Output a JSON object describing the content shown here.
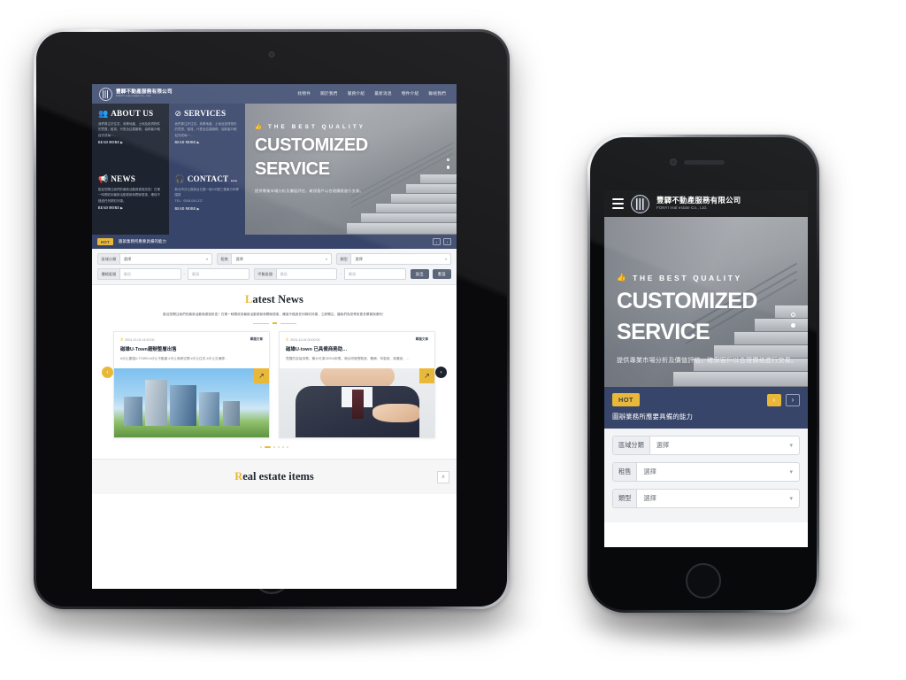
{
  "site": {
    "logo": {
      "cn": "豐驛不動產服務有限公司",
      "en": "FONYI real estate Co., Ltd.",
      "icon": "building-logo-icon"
    },
    "nav": [
      {
        "label": "找物件"
      },
      {
        "label": "關於我們"
      },
      {
        "label": "服務介紹"
      },
      {
        "label": "最新消息"
      },
      {
        "label": "物件介紹"
      },
      {
        "label": "聯絡我們"
      }
    ]
  },
  "cards": [
    {
      "id": "about-us",
      "icon": "people-icon",
      "glyph": "👥",
      "title": "ABOUT US",
      "body": "我們專注於住宅、商業地產、土地及投資物件的買賣、租賃、代售及估價服務，協助客戶輕鬆完成每一...",
      "more": "READ MORE ▶",
      "theme": "dark"
    },
    {
      "id": "services",
      "icon": "compass-icon",
      "glyph": "⊘",
      "title": "SERVICES",
      "body": "我們專注於住宅、商業地產、土地及投資物件的買賣、租賃、代售及估價服務，協助客戶輕鬆完成每一...",
      "more": "READ MORE ▶",
      "theme": "blue"
    },
    {
      "id": "news",
      "icon": "megaphone-icon",
      "glyph": "📢",
      "title": "NEWS",
      "body": "歡迎您關注我們的最新活動與優惠訊息！在第一時間收到最新活動更新和獨家優惠，確保不錯過任何精彩好康。",
      "more": "READ MORE ▶",
      "theme": "dark"
    },
    {
      "id": "contact",
      "icon": "headset-icon",
      "glyph": "🎧",
      "title": "CONTACT ...",
      "body": "新北市汐止區新台五路一段100號三樓東方科學園區",
      "tel": "TEL：0918-041-317",
      "more": "READ MORE ▶",
      "theme": "blue"
    }
  ],
  "hero": {
    "kicker": "THE BEST QUALITY",
    "kicker_icon": "thumbs-up-icon",
    "title_line1": "CUSTOMIZED",
    "title_line2": "SERVICE",
    "subtitle": "提供專業市場分析及價值評估，確保客戶以合理價格進行交易。",
    "dots": [
      "outline",
      "filled"
    ]
  },
  "hot": {
    "badge": "HOT",
    "text": "圖辦業務所應要具備的能力",
    "prev_icon": "chevron-left-icon",
    "next_icon": "chevron-right-icon",
    "prev": "‹",
    "next": "›"
  },
  "filter": {
    "row1": [
      {
        "label": "區域分類",
        "value": "選擇"
      },
      {
        "label": "租售",
        "value": "選擇"
      },
      {
        "label": "類型",
        "value": "選擇"
      }
    ],
    "row2": [
      {
        "label": "價格區間",
        "min": "最低",
        "max": "最高",
        "sep": "-"
      },
      {
        "label": "坪數區間",
        "min": "最低",
        "max": "最高",
        "sep": "-"
      }
    ],
    "buttons": [
      {
        "label": "送出"
      },
      {
        "label": "重設"
      }
    ],
    "caret_icon": "chevron-down-icon"
  },
  "news": {
    "title_first": "L",
    "title_rest": "atest News",
    "description": "歡迎您關注我們的最新活動與優惠訊息！在第一時間收到最新活動更新和獨家優惠，確保不錯過任何精彩好康，立即關注，讓我們為您帶來更多驚喜與便利！",
    "prev_icon": "carousel-prev-icon",
    "next_icon": "carousel-next-icon",
    "prev": "‹",
    "next": "›",
    "articles": [
      {
        "date": "2024-12-04 14:20:00",
        "clock_icon": "clock-icon",
        "tag": "專題文章",
        "title": "磁雄U-Town磨辦整層出售",
        "excerpt": "#汐止捷運U-TOWN #汐止不動產 #汐止商辦空間 #汐止住宅 #汐止交通便...",
        "badge_icon": "arrow-up-right-icon",
        "badge": "↗",
        "image": "city-skyline"
      },
      {
        "date": "2024-12-04 00:00:00",
        "clock_icon": "clock-icon",
        "tag": "專題文章",
        "title": "磁雄U-town 已具備商務助...",
        "excerpt": "寬闊的容量用電，最大可達1500A用電，適合研發實驗室、醫療、特製室、無塵室、...",
        "badge_icon": "arrow-up-right-icon",
        "badge": "↗",
        "image": "handshake"
      }
    ],
    "pagination": [
      {
        "active": false
      },
      {
        "active": true
      },
      {
        "active": false
      },
      {
        "active": false
      },
      {
        "active": false
      },
      {
        "active": false
      }
    ]
  },
  "footer": {
    "title_first": "R",
    "title_rest": "eal estate items",
    "back_to_top_icon": "chevron-up-icon",
    "back_to_top": "∧"
  },
  "phone": {
    "menu_icon": "hamburger-menu-icon"
  },
  "colors": {
    "navy": "#38456a",
    "dark": "#1d2430",
    "gold": "#eab839",
    "light_bg": "#f4f5f7"
  }
}
